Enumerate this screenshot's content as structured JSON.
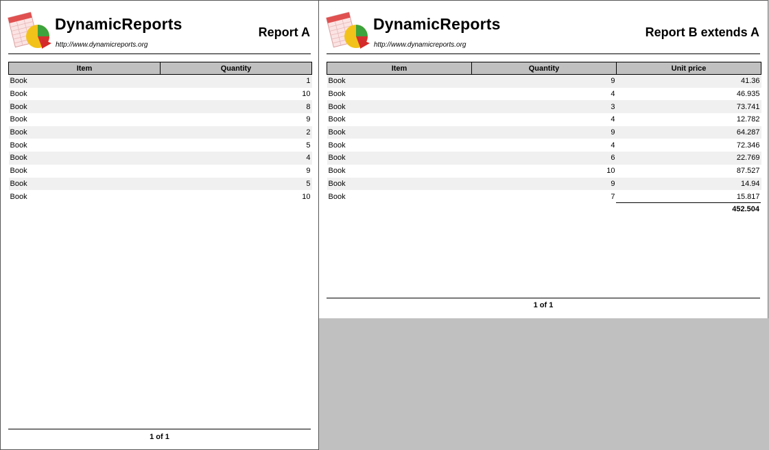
{
  "brand": {
    "name": "DynamicReports",
    "url": "http://www.dynamicreports.org"
  },
  "report_a": {
    "title": "Report A",
    "columns": [
      "Item",
      "Quantity"
    ],
    "rows": [
      {
        "item": "Book",
        "quantity": "1"
      },
      {
        "item": "Book",
        "quantity": "10"
      },
      {
        "item": "Book",
        "quantity": "8"
      },
      {
        "item": "Book",
        "quantity": "9"
      },
      {
        "item": "Book",
        "quantity": "2"
      },
      {
        "item": "Book",
        "quantity": "5"
      },
      {
        "item": "Book",
        "quantity": "4"
      },
      {
        "item": "Book",
        "quantity": "9"
      },
      {
        "item": "Book",
        "quantity": "5"
      },
      {
        "item": "Book",
        "quantity": "10"
      }
    ],
    "page_number": "1 of 1"
  },
  "report_b": {
    "title": "Report B extends A",
    "columns": [
      "Item",
      "Quantity",
      "Unit price"
    ],
    "rows": [
      {
        "item": "Book",
        "quantity": "9",
        "unit_price": "41.36"
      },
      {
        "item": "Book",
        "quantity": "4",
        "unit_price": "46.935"
      },
      {
        "item": "Book",
        "quantity": "3",
        "unit_price": "73.741"
      },
      {
        "item": "Book",
        "quantity": "4",
        "unit_price": "12.782"
      },
      {
        "item": "Book",
        "quantity": "9",
        "unit_price": "64.287"
      },
      {
        "item": "Book",
        "quantity": "4",
        "unit_price": "72.346"
      },
      {
        "item": "Book",
        "quantity": "6",
        "unit_price": "22.769"
      },
      {
        "item": "Book",
        "quantity": "10",
        "unit_price": "87.527"
      },
      {
        "item": "Book",
        "quantity": "9",
        "unit_price": "14.94"
      },
      {
        "item": "Book",
        "quantity": "7",
        "unit_price": "15.817"
      }
    ],
    "unit_price_total": "452.504",
    "page_number": "1 of 1"
  },
  "icons": {
    "logo": "dynamicreports-logo-icon"
  },
  "colors": {
    "header_bg": "#c0c0c0",
    "odd_row_bg": "#f0f0f0",
    "viewer_bg": "#c0c0c0"
  }
}
